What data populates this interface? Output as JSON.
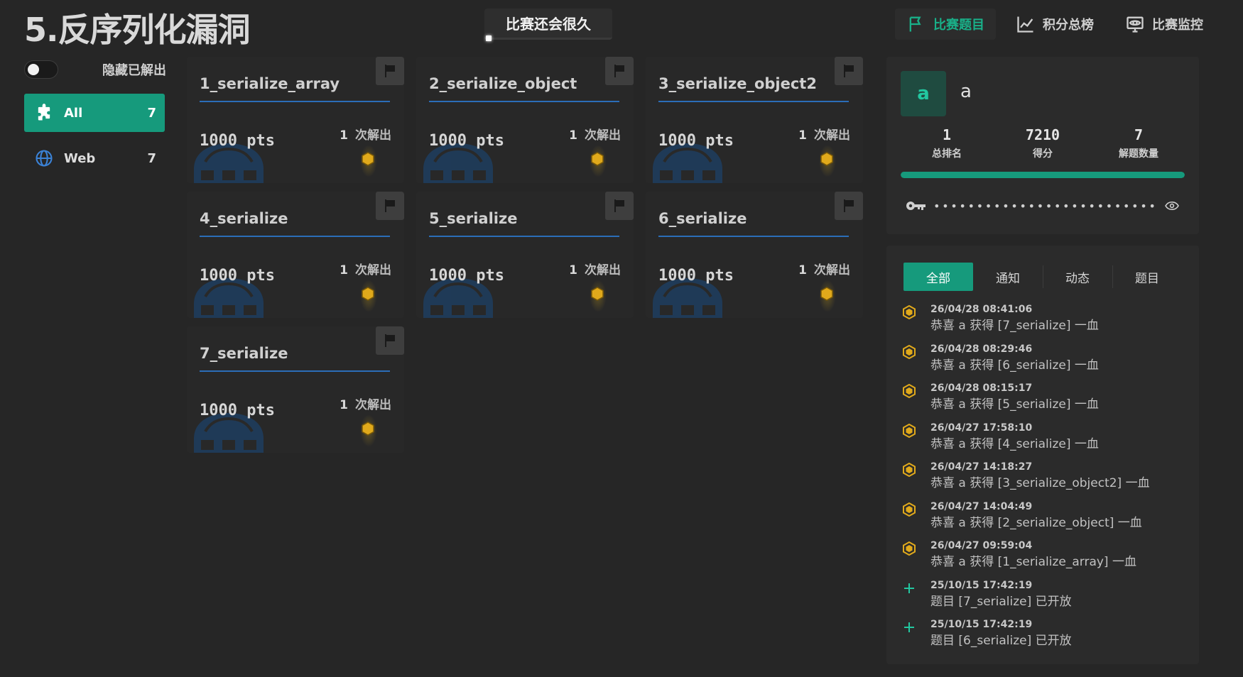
{
  "header": {
    "title": "5.反序列化漏洞",
    "countdown": "比赛还会很久",
    "nav": [
      {
        "label": "比赛题目",
        "icon": "flag-icon",
        "active": true
      },
      {
        "label": "积分总榜",
        "icon": "chart-line-icon",
        "active": false
      },
      {
        "label": "比赛监控",
        "icon": "monitor-eye-icon",
        "active": false
      }
    ]
  },
  "sidebar": {
    "hide_solved_label": "隐藏已解出",
    "categories": [
      {
        "label": "All",
        "count": "7",
        "icon": "puzzle-icon"
      },
      {
        "label": "Web",
        "count": "7",
        "icon": "globe-icon"
      }
    ]
  },
  "challenges": [
    {
      "name": "1_serialize_array",
      "pts": "1000 pts",
      "solves": "1",
      "solves_label": "次解出"
    },
    {
      "name": "2_serialize_object",
      "pts": "1000 pts",
      "solves": "1",
      "solves_label": "次解出"
    },
    {
      "name": "3_serialize_object2",
      "pts": "1000 pts",
      "solves": "1",
      "solves_label": "次解出"
    },
    {
      "name": "4_serialize",
      "pts": "1000 pts",
      "solves": "1",
      "solves_label": "次解出"
    },
    {
      "name": "5_serialize",
      "pts": "1000 pts",
      "solves": "1",
      "solves_label": "次解出"
    },
    {
      "name": "6_serialize",
      "pts": "1000 pts",
      "solves": "1",
      "solves_label": "次解出"
    },
    {
      "name": "7_serialize",
      "pts": "1000 pts",
      "solves": "1",
      "solves_label": "次解出"
    }
  ],
  "user": {
    "avatar": "a",
    "name": "a",
    "stats": [
      {
        "value": "1",
        "label": "总排名"
      },
      {
        "value": "7210",
        "label": "得分"
      },
      {
        "value": "7",
        "label": "解题数量"
      }
    ],
    "progress": 1.0,
    "token": "••••••••••••••••••••••••••••••"
  },
  "notices": {
    "tabs": [
      {
        "label": "全部",
        "active": true
      },
      {
        "label": "通知",
        "active": false
      },
      {
        "label": "动态",
        "active": false
      },
      {
        "label": "题目",
        "active": false
      }
    ],
    "events": [
      {
        "type": "blood",
        "time": "26/04/28 08:41:06",
        "msg": "恭喜 a 获得 [7_serialize] 一血"
      },
      {
        "type": "blood",
        "time": "26/04/28 08:29:46",
        "msg": "恭喜 a 获得 [6_serialize] 一血"
      },
      {
        "type": "blood",
        "time": "26/04/28 08:15:17",
        "msg": "恭喜 a 获得 [5_serialize] 一血"
      },
      {
        "type": "blood",
        "time": "26/04/27 17:58:10",
        "msg": "恭喜 a 获得 [4_serialize] 一血"
      },
      {
        "type": "blood",
        "time": "26/04/27 14:18:27",
        "msg": "恭喜 a 获得 [3_serialize_object2] 一血"
      },
      {
        "type": "blood",
        "time": "26/04/27 14:04:49",
        "msg": "恭喜 a 获得 [2_serialize_object] 一血"
      },
      {
        "type": "blood",
        "time": "26/04/27 09:59:04",
        "msg": "恭喜 a 获得 [1_serialize_array] 一血"
      },
      {
        "type": "new",
        "time": "25/10/15 17:42:19",
        "msg": "题目 [7_serialize] 已开放"
      },
      {
        "type": "new",
        "time": "25/10/15 17:42:19",
        "msg": "题目 [6_serialize] 已开放"
      }
    ]
  },
  "colors": {
    "accent": "#169a7c",
    "accent_text": "#19b089",
    "medal": "#e0a91b",
    "underline": "#2b6db8",
    "new_icon": "#22c7a0"
  }
}
